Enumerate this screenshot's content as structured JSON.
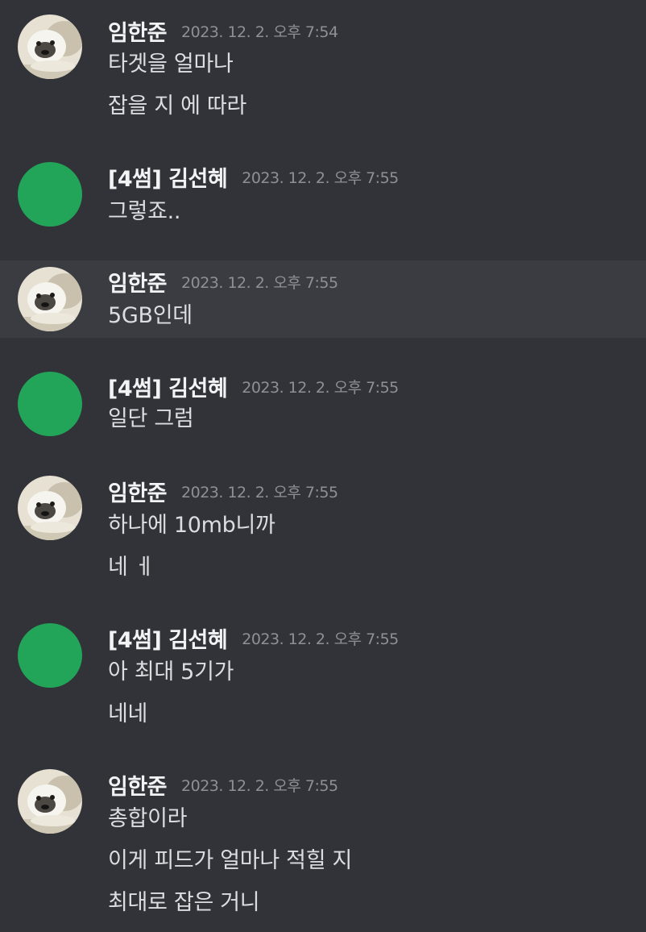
{
  "colors": {
    "background": "#313338",
    "highlight": "#3a3c42",
    "username": "#f2f3f5",
    "message_text": "#dbdee1",
    "timestamp": "#8e9096",
    "green_avatar": "#22a559"
  },
  "messages": [
    {
      "avatar": "dog-photo",
      "username": "임한준",
      "timestamp": "2023. 12. 2. 오후 7:54",
      "lines": [
        "타겟을 얼마나",
        "잡을 지 에 따라"
      ]
    },
    {
      "avatar": "green-default",
      "username": "[4썸] 김선혜",
      "timestamp": "2023. 12. 2. 오후 7:55",
      "lines": [
        "그렇죠.."
      ]
    },
    {
      "avatar": "dog-photo",
      "username": "임한준",
      "timestamp": "2023. 12. 2. 오후 7:55",
      "lines": [
        "5GB인데"
      ]
    },
    {
      "avatar": "green-default",
      "username": "[4썸] 김선혜",
      "timestamp": "2023. 12. 2. 오후 7:55",
      "lines": [
        "일단 그럼"
      ]
    },
    {
      "avatar": "dog-photo",
      "username": "임한준",
      "timestamp": "2023. 12. 2. 오후 7:55",
      "lines": [
        "하나에 10mb니까",
        "네 ㅔ"
      ]
    },
    {
      "avatar": "green-default",
      "username": "[4썸] 김선혜",
      "timestamp": "2023. 12. 2. 오후 7:55",
      "lines": [
        "아 최대 5기가",
        "네네"
      ]
    },
    {
      "avatar": "dog-photo",
      "username": "임한준",
      "timestamp": "2023. 12. 2. 오후 7:55",
      "lines": [
        "총합이라",
        "이게 피드가 얼마나 적힐 지",
        "최대로 잡은 거니"
      ]
    }
  ]
}
